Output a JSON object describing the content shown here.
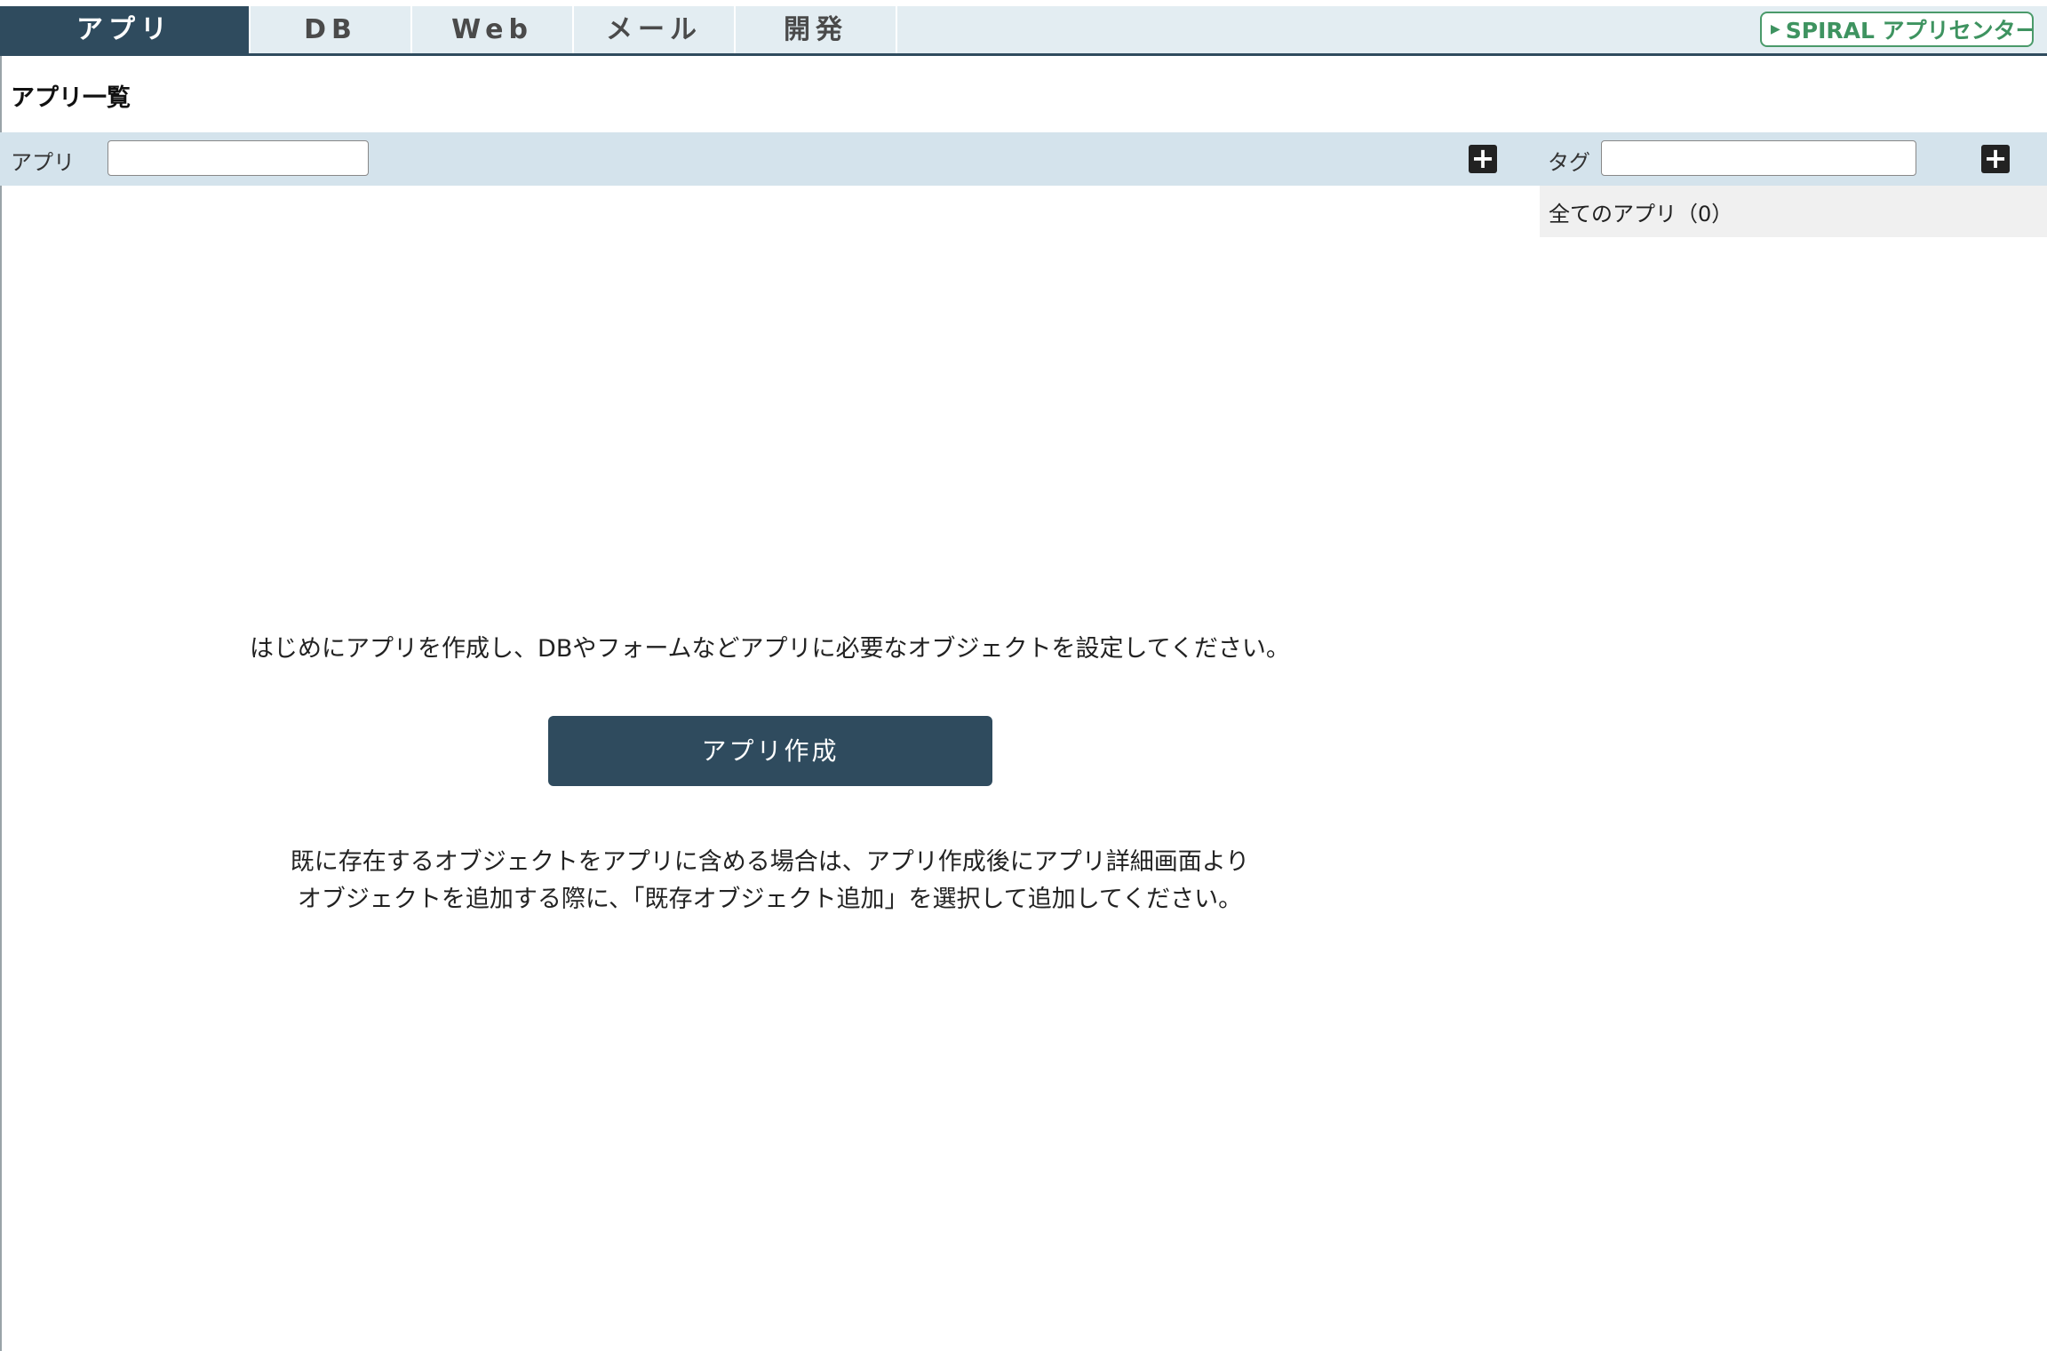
{
  "nav": {
    "tabs": [
      {
        "label": "アプリ",
        "active": true
      },
      {
        "label": "DB",
        "active": false
      },
      {
        "label": "Web",
        "active": false
      },
      {
        "label": "メール",
        "active": false
      },
      {
        "label": "開発",
        "active": false
      }
    ],
    "logo_text": "SPIRAL アプリセンター"
  },
  "page": {
    "title": "アプリ一覧"
  },
  "filters": {
    "app_label": "アプリ",
    "app_value": "",
    "tag_label": "タグ",
    "tag_value": ""
  },
  "tags": {
    "all_apps": "全てのアプリ（0）"
  },
  "main": {
    "intro": "はじめにアプリを作成し、DBやフォームなどアプリに必要なオブジェクトを設定してください。",
    "create_button": "アプリ作成",
    "note_line1": "既に存在するオブジェクトをアプリに含める場合は、アプリ作成後にアプリ詳細画面より",
    "note_line2": "オブジェクトを追加する際に、「既存オブジェクト追加」を選択して追加してください。"
  },
  "colors": {
    "primary": "#2f4b5e",
    "nav_bg": "#e3edf2",
    "filter_bg": "#d4e3ec",
    "logo_green": "#3e9360"
  },
  "icons": {
    "add_app": "plus-icon",
    "add_tag": "plus-icon",
    "logo_play": "play-icon",
    "logo_plane": "airplane-icon"
  }
}
